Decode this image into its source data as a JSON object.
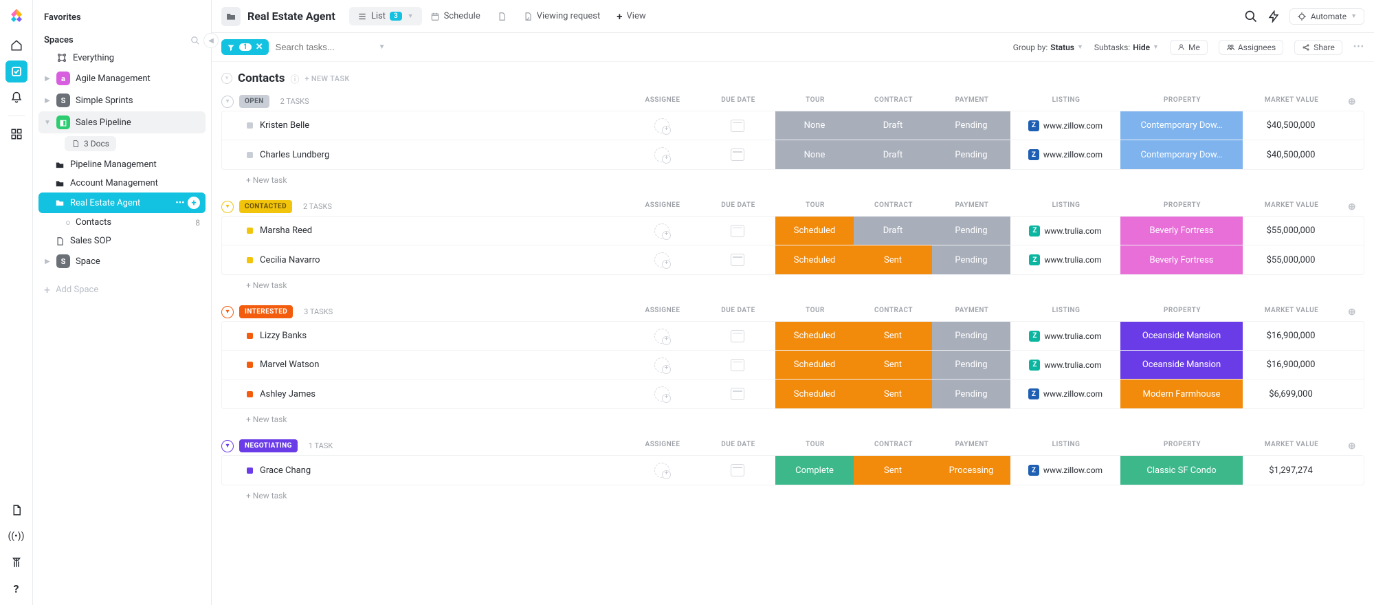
{
  "sidebar": {
    "favorites": "Favorites",
    "spaces": "Spaces",
    "everything": "Everything",
    "agile": "Agile Management",
    "sprints": "Simple Sprints",
    "pipeline": "Sales Pipeline",
    "docs_pill": "3 Docs",
    "pipeline_mgmt": "Pipeline Management",
    "account_mgmt": "Account Management",
    "real_estate": "Real Estate Agent",
    "contacts": "Contacts",
    "contacts_count": "8",
    "sales_sop": "Sales SOP",
    "space": "Space",
    "add_space": "Add Space"
  },
  "header": {
    "title": "Real Estate Agent",
    "tabs": {
      "list": "List",
      "list_badge": "3",
      "schedule": "Schedule",
      "viewing": "Viewing request",
      "view": "View"
    },
    "automate": "Automate"
  },
  "toolbar": {
    "filter_count": "1",
    "search_placeholder": "Search tasks...",
    "group_by_label": "Group by:",
    "group_by_value": "Status",
    "subtasks_label": "Subtasks:",
    "subtasks_value": "Hide",
    "me": "Me",
    "assignees": "Assignees",
    "share": "Share"
  },
  "list": {
    "title": "Contacts",
    "new_task_hdr": "+ NEW TASK",
    "new_task_row": "+ New task",
    "columns": {
      "assignee": "ASSIGNEE",
      "due": "DUE DATE",
      "tour": "TOUR",
      "contract": "CONTRACT",
      "payment": "PAYMENT",
      "listing": "LISTING",
      "property": "PROPERTY",
      "market_value": "MARKET VALUE"
    }
  },
  "colors": {
    "grey": "#A8AEBA",
    "orange": "#F28B0C",
    "orange2": "#F28B0C",
    "green": "#3DB88B",
    "property_blue": "#7EB3EE",
    "property_pink": "#E86FD8",
    "property_purple": "#6A3CE8",
    "property_green": "#3DB88B",
    "zillow": "#1E5FB3",
    "trulia": "#0BB5A0"
  },
  "groups": [
    {
      "status": "OPEN",
      "status_bg": "#C9CED6",
      "status_fg": "#5a6068",
      "toggle_color": "#C9CED6",
      "count": "2 TASKS",
      "rows": [
        {
          "name": "Kristen Belle",
          "bullet": "#C9CED6",
          "tour": {
            "t": "None",
            "c": "#A8AEBA"
          },
          "contract": {
            "t": "Draft",
            "c": "#A8AEBA"
          },
          "payment": {
            "t": "Pending",
            "c": "#A8AEBA"
          },
          "listing": {
            "t": "www.zillow.com",
            "ic": "#1E5FB3"
          },
          "property": {
            "t": "Contemporary Dow…",
            "c": "#7EB3EE"
          },
          "mv": "$40,500,000"
        },
        {
          "name": "Charles Lundberg",
          "bullet": "#C9CED6",
          "tour": {
            "t": "None",
            "c": "#A8AEBA"
          },
          "contract": {
            "t": "Draft",
            "c": "#A8AEBA"
          },
          "payment": {
            "t": "Pending",
            "c": "#A8AEBA"
          },
          "listing": {
            "t": "www.zillow.com",
            "ic": "#1E5FB3"
          },
          "property": {
            "t": "Contemporary Dow…",
            "c": "#7EB3EE"
          },
          "mv": "$40,500,000"
        }
      ]
    },
    {
      "status": "CONTACTED",
      "status_bg": "#F2C40C",
      "status_fg": "#6b5300",
      "toggle_color": "#F2C40C",
      "count": "2 TASKS",
      "rows": [
        {
          "name": "Marsha Reed",
          "bullet": "#F2C40C",
          "tour": {
            "t": "Scheduled",
            "c": "#F28B0C"
          },
          "contract": {
            "t": "Draft",
            "c": "#A8AEBA"
          },
          "payment": {
            "t": "Pending",
            "c": "#A8AEBA"
          },
          "listing": {
            "t": "www.trulia.com",
            "ic": "#0BB5A0"
          },
          "property": {
            "t": "Beverly Fortress",
            "c": "#E86FD8"
          },
          "mv": "$55,000,000"
        },
        {
          "name": "Cecilia Navarro",
          "bullet": "#F2C40C",
          "tour": {
            "t": "Scheduled",
            "c": "#F28B0C"
          },
          "contract": {
            "t": "Sent",
            "c": "#F28B0C"
          },
          "payment": {
            "t": "Pending",
            "c": "#A8AEBA"
          },
          "listing": {
            "t": "www.trulia.com",
            "ic": "#0BB5A0"
          },
          "property": {
            "t": "Beverly Fortress",
            "c": "#E86FD8"
          },
          "mv": "$55,000,000"
        }
      ]
    },
    {
      "status": "INTERESTED",
      "status_bg": "#F25C0C",
      "status_fg": "#ffffff",
      "toggle_color": "#F25C0C",
      "count": "3 TASKS",
      "rows": [
        {
          "name": "Lizzy Banks",
          "bullet": "#F25C0C",
          "tour": {
            "t": "Scheduled",
            "c": "#F28B0C"
          },
          "contract": {
            "t": "Sent",
            "c": "#F28B0C"
          },
          "payment": {
            "t": "Pending",
            "c": "#A8AEBA"
          },
          "listing": {
            "t": "www.trulia.com",
            "ic": "#0BB5A0"
          },
          "property": {
            "t": "Oceanside Mansion",
            "c": "#6A3CE8"
          },
          "mv": "$16,900,000"
        },
        {
          "name": "Marvel Watson",
          "bullet": "#F25C0C",
          "tour": {
            "t": "Scheduled",
            "c": "#F28B0C"
          },
          "contract": {
            "t": "Sent",
            "c": "#F28B0C"
          },
          "payment": {
            "t": "Pending",
            "c": "#A8AEBA"
          },
          "listing": {
            "t": "www.trulia.com",
            "ic": "#0BB5A0"
          },
          "property": {
            "t": "Oceanside Mansion",
            "c": "#6A3CE8"
          },
          "mv": "$16,900,000"
        },
        {
          "name": "Ashley James",
          "bullet": "#F25C0C",
          "tour": {
            "t": "Scheduled",
            "c": "#F28B0C"
          },
          "contract": {
            "t": "Sent",
            "c": "#F28B0C"
          },
          "payment": {
            "t": "Pending",
            "c": "#A8AEBA"
          },
          "listing": {
            "t": "www.zillow.com",
            "ic": "#1E5FB3"
          },
          "property": {
            "t": "Modern Farmhouse",
            "c": "#F28B0C"
          },
          "mv": "$6,699,000"
        }
      ]
    },
    {
      "status": "NEGOTIATING",
      "status_bg": "#6A3CE8",
      "status_fg": "#ffffff",
      "toggle_color": "#6A3CE8",
      "count": "1 TASK",
      "rows": [
        {
          "name": "Grace Chang",
          "bullet": "#6A3CE8",
          "tour": {
            "t": "Complete",
            "c": "#3DB88B"
          },
          "contract": {
            "t": "Sent",
            "c": "#F28B0C"
          },
          "payment": {
            "t": "Processing",
            "c": "#F28B0C"
          },
          "listing": {
            "t": "www.zillow.com",
            "ic": "#1E5FB3"
          },
          "property": {
            "t": "Classic SF Condo",
            "c": "#3DB88B"
          },
          "mv": "$1,297,274"
        }
      ]
    }
  ]
}
